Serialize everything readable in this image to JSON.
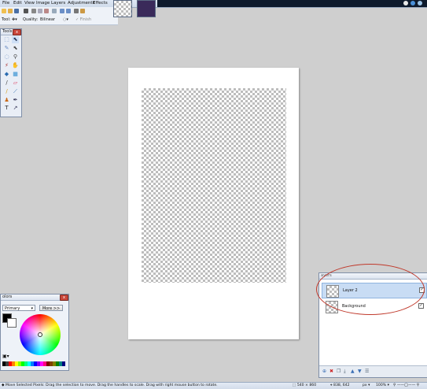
{
  "menu": {
    "items": [
      "File",
      "Edit",
      "View",
      "Image",
      "Layers",
      "Adjustments",
      "Effects"
    ]
  },
  "toolbar": {
    "tool_label": "Tool:",
    "quality_label": "Quality:",
    "quality_value": "Bilinear",
    "finish_label": "Finish"
  },
  "tools_window": {
    "title": "Tools",
    "close_label": "x"
  },
  "colors_window": {
    "title": "olors",
    "mode_value": "Primary",
    "more_label": "More >>"
  },
  "layers_window": {
    "title": "ayers",
    "layers": [
      {
        "name": "Layer 2",
        "visible": "✓"
      },
      {
        "name": "Background",
        "visible": "✓"
      }
    ]
  },
  "status": {
    "hint": "Move Selected Pixels: Drag the selection to move. Drag the handles to scale. Drag with right mouse button to rotate.",
    "selection_size": "540 × 860",
    "pointer_pos": "838, 642",
    "unit": "px",
    "zoom": "100%"
  },
  "colors": {
    "accent": "#c0392b",
    "highlight": "#c8dcf4",
    "palette": [
      "#000000",
      "#404040",
      "#ff0000",
      "#ff8000",
      "#ffff00",
      "#80ff00",
      "#00ff00",
      "#00ff80",
      "#00ffff",
      "#0080ff",
      "#0000ff",
      "#8000ff",
      "#ff00ff",
      "#ff0080",
      "#800000",
      "#804000",
      "#808000",
      "#008000",
      "#008080",
      "#000080"
    ]
  }
}
